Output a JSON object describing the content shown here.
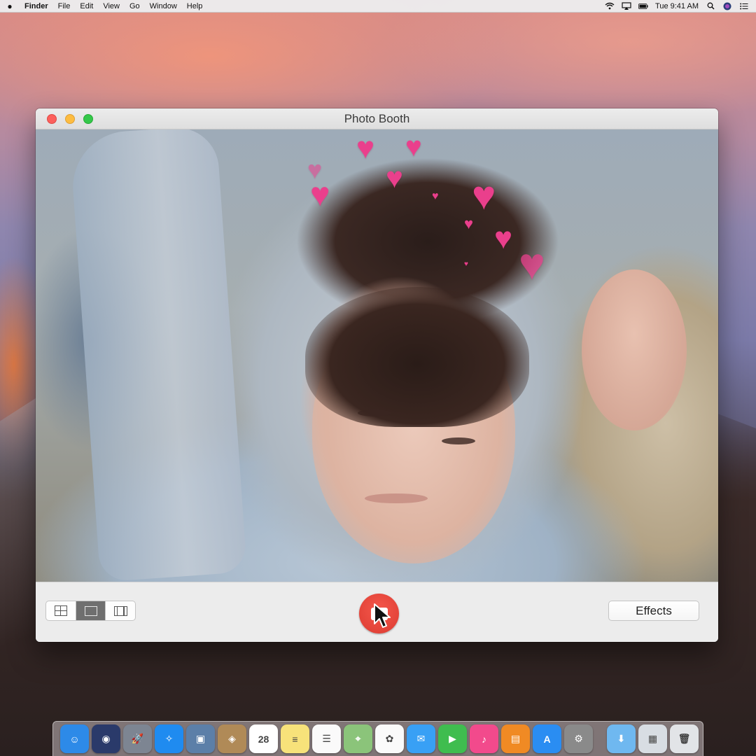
{
  "menubar": {
    "apple_icon": "apple-icon",
    "items": [
      "Finder",
      "File",
      "Edit",
      "View",
      "Go",
      "Window",
      "Help"
    ],
    "status_icons": [
      "wifi-icon",
      "airplay-icon",
      "battery-icon"
    ],
    "clock": "Tue 9:41 AM",
    "trailing_icons": [
      "spotlight-icon",
      "siri-icon",
      "notification-center-icon"
    ]
  },
  "window": {
    "title": "Photo Booth",
    "toolbar": {
      "view_modes": [
        "grid-view-icon",
        "single-photo-icon",
        "film-strip-icon"
      ],
      "active_view": "single-photo-icon",
      "shutter_icon": "camera-icon",
      "effects_label": "Effects"
    },
    "camera_overlay": "hearts-effect"
  },
  "dock": {
    "apps": [
      {
        "name": "finder",
        "color": "#2d8ae8",
        "glyph": "☺"
      },
      {
        "name": "siri",
        "color": "#2a3a6a",
        "glyph": "◉"
      },
      {
        "name": "launchpad",
        "color": "#7d8592",
        "glyph": "🚀"
      },
      {
        "name": "safari",
        "color": "#1f8bf0",
        "glyph": "✧"
      },
      {
        "name": "photo-viewer",
        "color": "#5c7fa8",
        "glyph": "▣"
      },
      {
        "name": "contacts",
        "color": "#b08a57",
        "glyph": "◈"
      },
      {
        "name": "calendar",
        "color": "#ffffff",
        "glyph": "28"
      },
      {
        "name": "notes",
        "color": "#f7e27a",
        "glyph": "≡"
      },
      {
        "name": "reminders",
        "color": "#fafafa",
        "glyph": "☰"
      },
      {
        "name": "maps",
        "color": "#8bc47a",
        "glyph": "⌖"
      },
      {
        "name": "photos",
        "color": "#fafafa",
        "glyph": "✿"
      },
      {
        "name": "messages",
        "color": "#38a0f5",
        "glyph": "✉"
      },
      {
        "name": "facetime",
        "color": "#3fbd4f",
        "glyph": "▶"
      },
      {
        "name": "itunes",
        "color": "#f24a8c",
        "glyph": "♪"
      },
      {
        "name": "ibooks",
        "color": "#f08a24",
        "glyph": "▤"
      },
      {
        "name": "app-store",
        "color": "#2a8df2",
        "glyph": "A"
      },
      {
        "name": "system-preferences",
        "color": "#8a8a8a",
        "glyph": "⚙"
      }
    ],
    "trailing": [
      {
        "name": "downloads-folder",
        "color": "#6fb8f0",
        "glyph": "⬇"
      },
      {
        "name": "network-stack",
        "color": "#d8dde3",
        "glyph": "▦"
      },
      {
        "name": "trash",
        "color": "#e2e4e7",
        "glyph": "🗑"
      }
    ]
  }
}
